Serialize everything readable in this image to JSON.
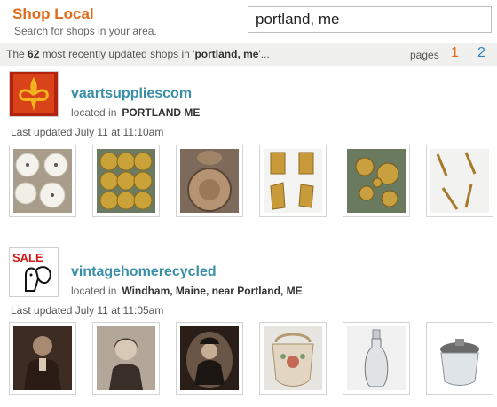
{
  "header": {
    "title": "Shop Local",
    "subtitle": "Search for shops in your area.",
    "search_value": "portland, me"
  },
  "results": {
    "prefix": "The",
    "count": "62",
    "middle": "most recently updated shops in '",
    "query": "portland, me",
    "suffix": "'...",
    "pages_label": "pages",
    "pages": [
      "1",
      "2"
    ],
    "current_page": "1"
  },
  "shops": [
    {
      "name": "vaartsuppliescom",
      "located_label": "located in",
      "location": "PORTLAND ME",
      "updated": "Last updated July 11 at 11:10am",
      "avatar_icon": "fleur-de-lis-icon",
      "items": [
        "watch-dials",
        "brass-filigree-buttons",
        "round-brass-plate",
        "brass-hinges",
        "clock-gears",
        "brass-hands"
      ]
    },
    {
      "name": "vintagehomerecycled",
      "located_label": "located in",
      "location": "Windham, Maine, near Portland, ME",
      "updated": "Last updated July 11 at 11:05am",
      "avatar_text": "SALE",
      "avatar_icon": "squirrel-sale-sign-icon",
      "items": [
        "portrait-man",
        "portrait-girl",
        "portrait-woman-oval",
        "beaded-purse",
        "glass-decanter",
        "crystal-jar"
      ]
    }
  ],
  "colors": {
    "accent": "#e06a17",
    "link": "#3a8fa8",
    "page2": "#2a86c3",
    "bar": "#f0f0ee"
  }
}
